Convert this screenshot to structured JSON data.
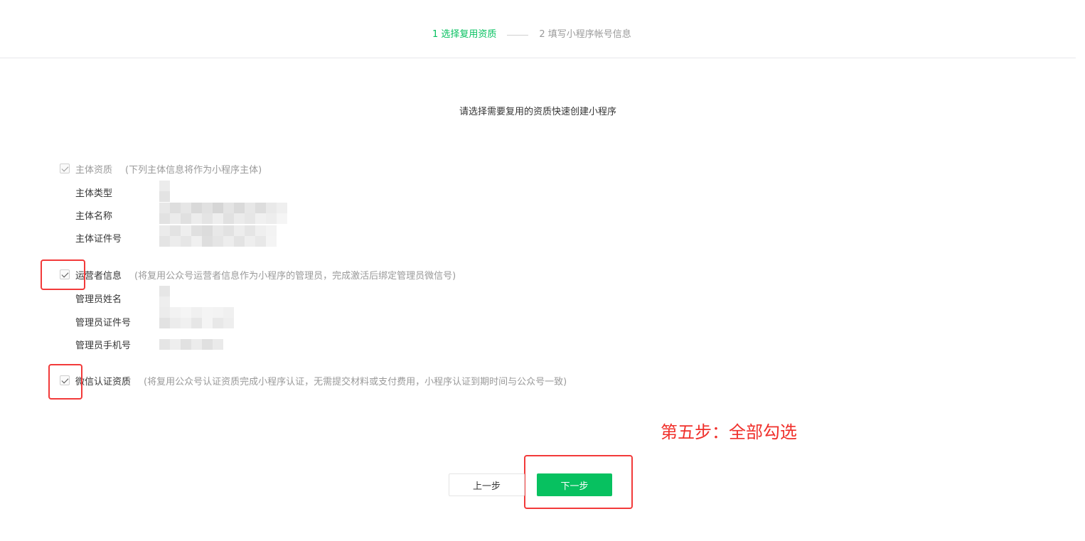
{
  "steps": {
    "step1": "1 选择复用资质",
    "step2": "2 填写小程序帐号信息"
  },
  "subtitle": "请选择需要复用的资质快速创建小程序",
  "entity": {
    "label": "主体资质",
    "note": "(下列主体信息将作为小程序主体)",
    "checked": true,
    "fields": [
      "主体类型",
      "主体名称",
      "主体证件号"
    ]
  },
  "operator": {
    "label": "运营者信息",
    "note": "(将复用公众号运营者信息作为小程序的管理员，完成激活后绑定管理员微信号)",
    "checked": true,
    "fields": [
      "管理员姓名",
      "管理员证件号",
      "管理员手机号"
    ]
  },
  "wechat": {
    "label": "微信认证资质",
    "note": "(将复用公众号认证资质完成小程序认证，无需提交材料或支付费用，小程序认证到期时间与公众号一致)",
    "checked": true
  },
  "annotation": "第五步：全部勾选",
  "buttons": {
    "prev": "上一步",
    "next": "下一步"
  },
  "colors": {
    "accent": "#07c160",
    "annotation_red": "#f0302b"
  }
}
